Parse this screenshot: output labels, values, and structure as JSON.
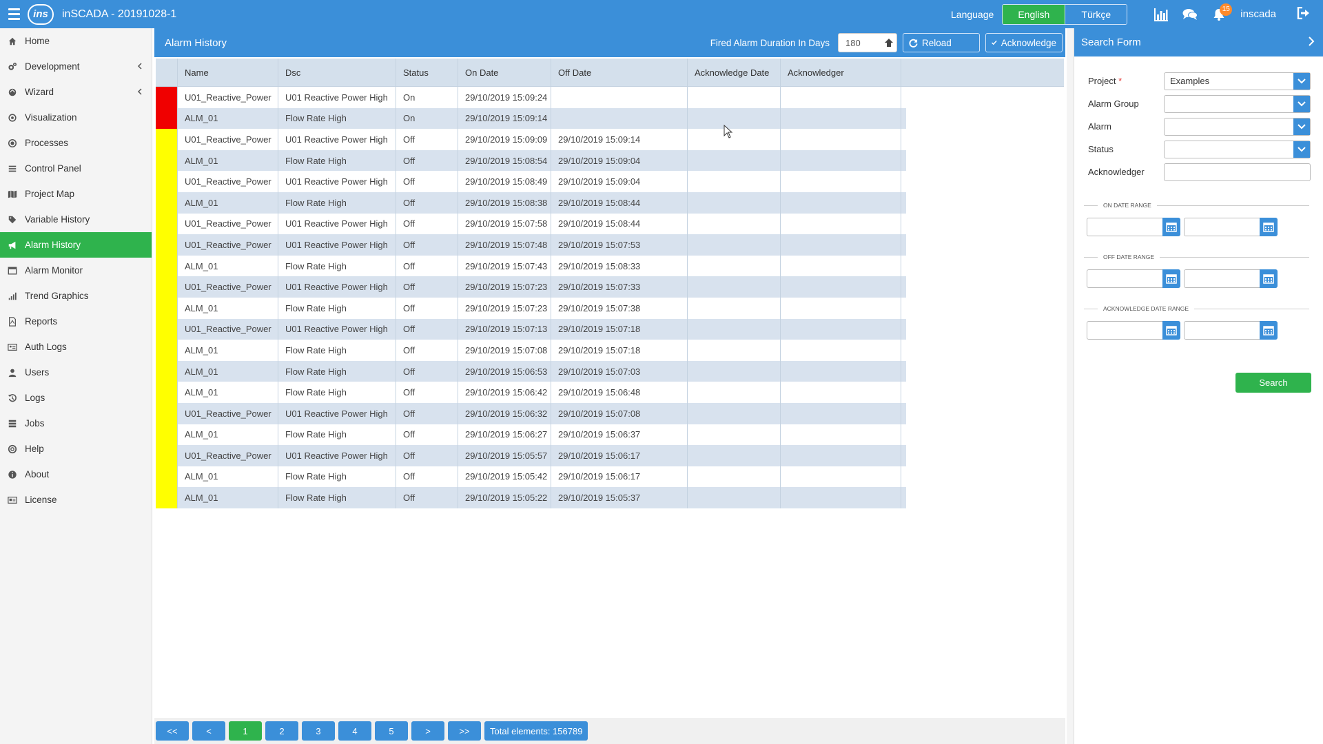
{
  "app": {
    "title": "inSCADA - 20191028-1",
    "logo_text": "ins"
  },
  "topbar": {
    "language_label": "Language",
    "languages": [
      "English",
      "Türkçe"
    ],
    "active_language": "English",
    "notification_count": "15",
    "user": "inscada"
  },
  "sidebar": {
    "items": [
      {
        "label": "Home",
        "icon": "home-icon"
      },
      {
        "label": "Development",
        "icon": "cogs-icon",
        "has_submenu": true
      },
      {
        "label": "Wizard",
        "icon": "magic-icon",
        "has_submenu": true
      },
      {
        "label": "Visualization",
        "icon": "eye-icon"
      },
      {
        "label": "Processes",
        "icon": "circle-dot-icon"
      },
      {
        "label": "Control Panel",
        "icon": "sliders-icon"
      },
      {
        "label": "Project Map",
        "icon": "map-icon"
      },
      {
        "label": "Variable History",
        "icon": "tags-icon"
      },
      {
        "label": "Alarm History",
        "icon": "bullhorn-icon",
        "active": true
      },
      {
        "label": "Alarm Monitor",
        "icon": "window-icon"
      },
      {
        "label": "Trend Graphics",
        "icon": "signal-icon"
      },
      {
        "label": "Reports",
        "icon": "file-pdf-icon"
      },
      {
        "label": "Auth Logs",
        "icon": "id-card-icon"
      },
      {
        "label": "Users",
        "icon": "user-icon"
      },
      {
        "label": "Logs",
        "icon": "history-icon"
      },
      {
        "label": "Jobs",
        "icon": "server-icon"
      },
      {
        "label": "Help",
        "icon": "life-ring-icon"
      },
      {
        "label": "About",
        "icon": "info-icon"
      },
      {
        "label": "License",
        "icon": "license-icon"
      }
    ]
  },
  "main": {
    "title": "Alarm History",
    "fired_label": "Fired Alarm Duration In Days",
    "fired_days": "180",
    "reload_label": "Reload",
    "acknowledge_label": "Acknowledge",
    "columns": [
      "",
      "Name",
      "Dsc",
      "Status",
      "On Date",
      "Off Date",
      "Acknowledge Date",
      "Acknowledger"
    ],
    "rows": [
      {
        "flag": "red",
        "name": "U01_Reactive_Power",
        "dsc": "U01 Reactive Power High",
        "status": "On",
        "on": "29/10/2019 15:09:24",
        "off": ""
      },
      {
        "flag": "red",
        "name": "ALM_01",
        "dsc": "Flow Rate High",
        "status": "On",
        "on": "29/10/2019 15:09:14",
        "off": ""
      },
      {
        "flag": "yellow",
        "name": "U01_Reactive_Power",
        "dsc": "U01 Reactive Power High",
        "status": "Off",
        "on": "29/10/2019 15:09:09",
        "off": "29/10/2019 15:09:14"
      },
      {
        "flag": "yellow",
        "name": "ALM_01",
        "dsc": "Flow Rate High",
        "status": "Off",
        "on": "29/10/2019 15:08:54",
        "off": "29/10/2019 15:09:04"
      },
      {
        "flag": "yellow",
        "name": "U01_Reactive_Power",
        "dsc": "U01 Reactive Power High",
        "status": "Off",
        "on": "29/10/2019 15:08:49",
        "off": "29/10/2019 15:09:04"
      },
      {
        "flag": "yellow",
        "name": "ALM_01",
        "dsc": "Flow Rate High",
        "status": "Off",
        "on": "29/10/2019 15:08:38",
        "off": "29/10/2019 15:08:44"
      },
      {
        "flag": "yellow",
        "name": "U01_Reactive_Power",
        "dsc": "U01 Reactive Power High",
        "status": "Off",
        "on": "29/10/2019 15:07:58",
        "off": "29/10/2019 15:08:44"
      },
      {
        "flag": "yellow",
        "name": "U01_Reactive_Power",
        "dsc": "U01 Reactive Power High",
        "status": "Off",
        "on": "29/10/2019 15:07:48",
        "off": "29/10/2019 15:07:53"
      },
      {
        "flag": "yellow",
        "name": "ALM_01",
        "dsc": "Flow Rate High",
        "status": "Off",
        "on": "29/10/2019 15:07:43",
        "off": "29/10/2019 15:08:33"
      },
      {
        "flag": "yellow",
        "name": "U01_Reactive_Power",
        "dsc": "U01 Reactive Power High",
        "status": "Off",
        "on": "29/10/2019 15:07:23",
        "off": "29/10/2019 15:07:33"
      },
      {
        "flag": "yellow",
        "name": "ALM_01",
        "dsc": "Flow Rate High",
        "status": "Off",
        "on": "29/10/2019 15:07:23",
        "off": "29/10/2019 15:07:38"
      },
      {
        "flag": "yellow",
        "name": "U01_Reactive_Power",
        "dsc": "U01 Reactive Power High",
        "status": "Off",
        "on": "29/10/2019 15:07:13",
        "off": "29/10/2019 15:07:18"
      },
      {
        "flag": "yellow",
        "name": "ALM_01",
        "dsc": "Flow Rate High",
        "status": "Off",
        "on": "29/10/2019 15:07:08",
        "off": "29/10/2019 15:07:18"
      },
      {
        "flag": "yellow",
        "name": "ALM_01",
        "dsc": "Flow Rate High",
        "status": "Off",
        "on": "29/10/2019 15:06:53",
        "off": "29/10/2019 15:07:03"
      },
      {
        "flag": "yellow",
        "name": "ALM_01",
        "dsc": "Flow Rate High",
        "status": "Off",
        "on": "29/10/2019 15:06:42",
        "off": "29/10/2019 15:06:48"
      },
      {
        "flag": "yellow",
        "name": "U01_Reactive_Power",
        "dsc": "U01 Reactive Power High",
        "status": "Off",
        "on": "29/10/2019 15:06:32",
        "off": "29/10/2019 15:07:08"
      },
      {
        "flag": "yellow",
        "name": "ALM_01",
        "dsc": "Flow Rate High",
        "status": "Off",
        "on": "29/10/2019 15:06:27",
        "off": "29/10/2019 15:06:37"
      },
      {
        "flag": "yellow",
        "name": "U01_Reactive_Power",
        "dsc": "U01 Reactive Power High",
        "status": "Off",
        "on": "29/10/2019 15:05:57",
        "off": "29/10/2019 15:06:17"
      },
      {
        "flag": "yellow",
        "name": "ALM_01",
        "dsc": "Flow Rate High",
        "status": "Off",
        "on": "29/10/2019 15:05:42",
        "off": "29/10/2019 15:06:17"
      },
      {
        "flag": "yellow",
        "name": "ALM_01",
        "dsc": "Flow Rate High",
        "status": "Off",
        "on": "29/10/2019 15:05:22",
        "off": "29/10/2019 15:05:37"
      }
    ]
  },
  "pagination": {
    "first": "<<",
    "prev": "<",
    "pages": [
      "1",
      "2",
      "3",
      "4",
      "5"
    ],
    "active": "1",
    "next": ">",
    "last": ">>",
    "total": "Total elements: 156789"
  },
  "search": {
    "title": "Search Form",
    "project_label": "Project",
    "required_mark": "*",
    "project_value": "Examples",
    "alarm_group_label": "Alarm Group",
    "alarm_label": "Alarm",
    "status_label": "Status",
    "acknowledger_label": "Acknowledger",
    "on_date_range": "ON DATE RANGE",
    "off_date_range": "OFF DATE RANGE",
    "ack_date_range": "ACKNOWLEDGE DATE RANGE",
    "search_label": "Search"
  },
  "colors": {
    "accent": "#3b8fd9",
    "active": "#2fb34d",
    "alarm_on": "#f00000",
    "alarm_off": "#ffff00"
  }
}
